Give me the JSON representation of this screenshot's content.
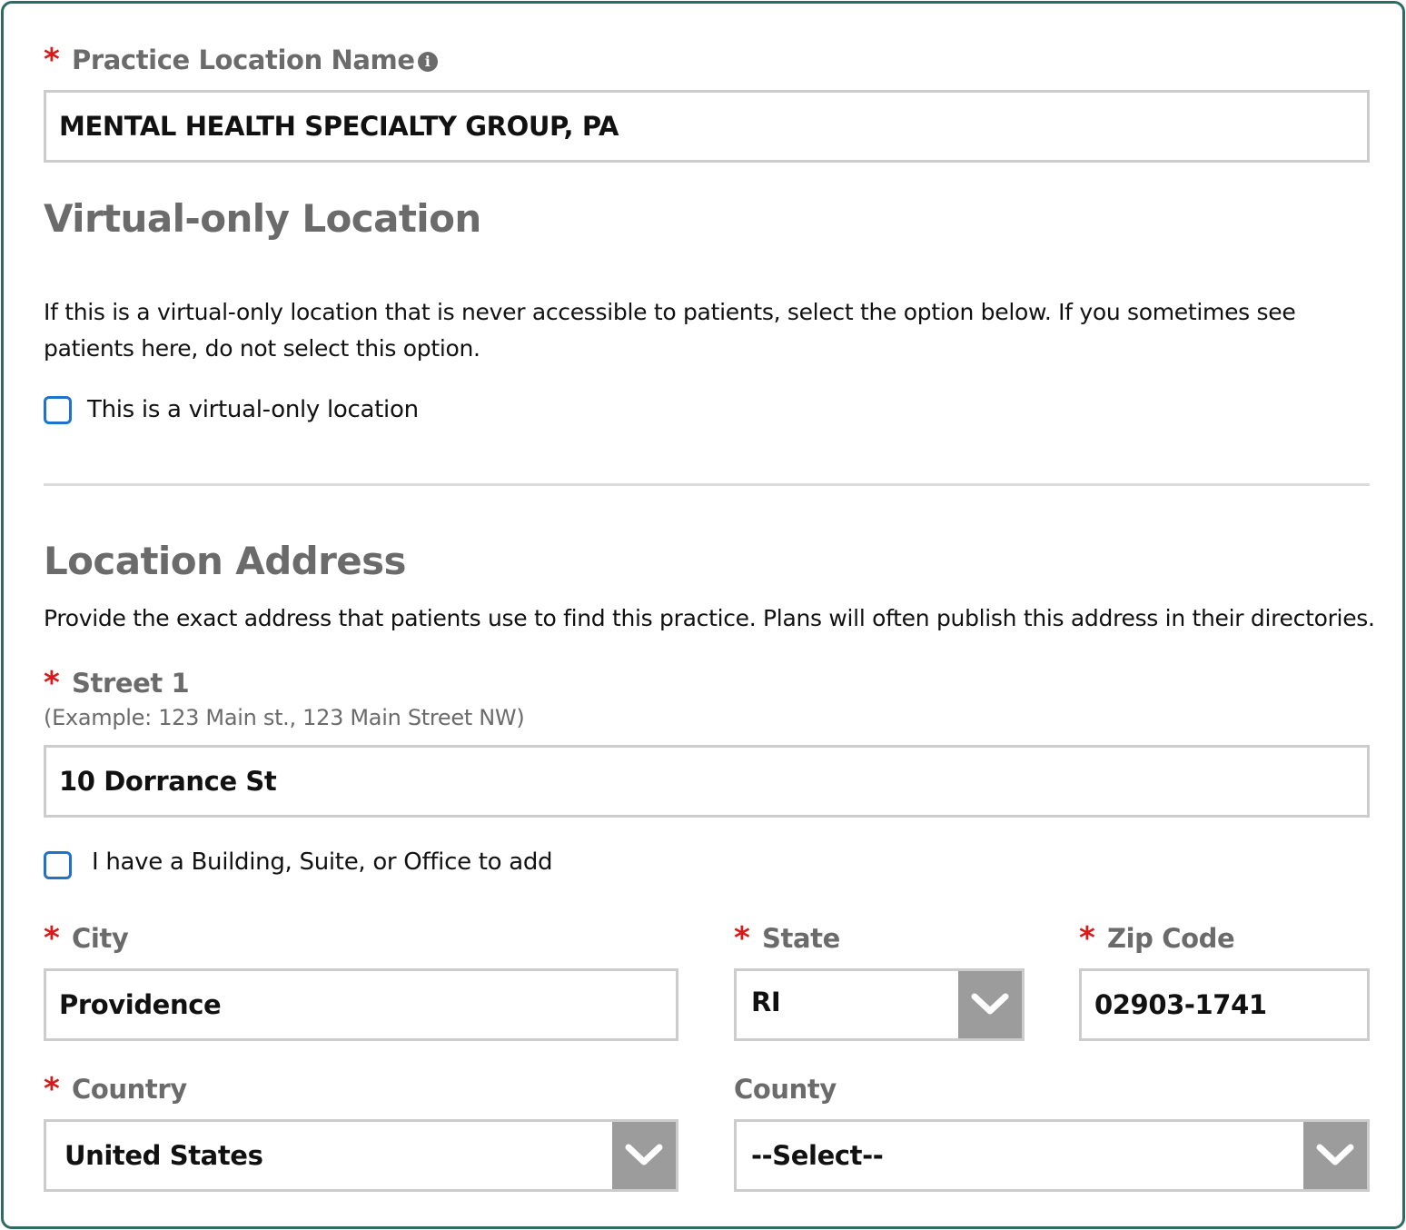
{
  "practice": {
    "name_label": "Practice Location Name",
    "name_value": "MENTAL HEALTH SPECIALTY GROUP, PA"
  },
  "virtual": {
    "heading": "Virtual-only Location",
    "description": "If this is a virtual-only location that is never accessible to patients, select the option below. If you sometimes see patients here, do not select this option.",
    "checkbox_label": "This is a virtual-only location",
    "checked": false
  },
  "address": {
    "heading": "Location Address",
    "description": "Provide the exact address that patients use to find this practice. Plans will often publish this address in their directories.",
    "street1_label": "Street 1",
    "street1_hint": "(Example: 123 Main st., 123 Main Street NW)",
    "street1_value": "10 Dorrance St",
    "suite_checkbox_label": "I have a Building, Suite, or Office to add",
    "suite_checked": false,
    "city_label": "City",
    "city_value": "Providence",
    "state_label": "State",
    "state_value": "RI",
    "zip_label": "Zip Code",
    "zip_value": "02903-1741",
    "country_label": "Country",
    "country_value": "United States",
    "county_label": "County",
    "county_value": "--Select--"
  },
  "icons": {
    "required": "asterisk",
    "info": "info-circle-icon",
    "dropdown": "chevron-down-icon"
  },
  "colors": {
    "frame_border": "#2e6b63",
    "required_marker": "#d81a1a",
    "label_gray": "#6b6b6b",
    "checkbox_blue": "#1f74c9",
    "select_button": "#9c9c9c",
    "input_border": "#cccccc"
  }
}
